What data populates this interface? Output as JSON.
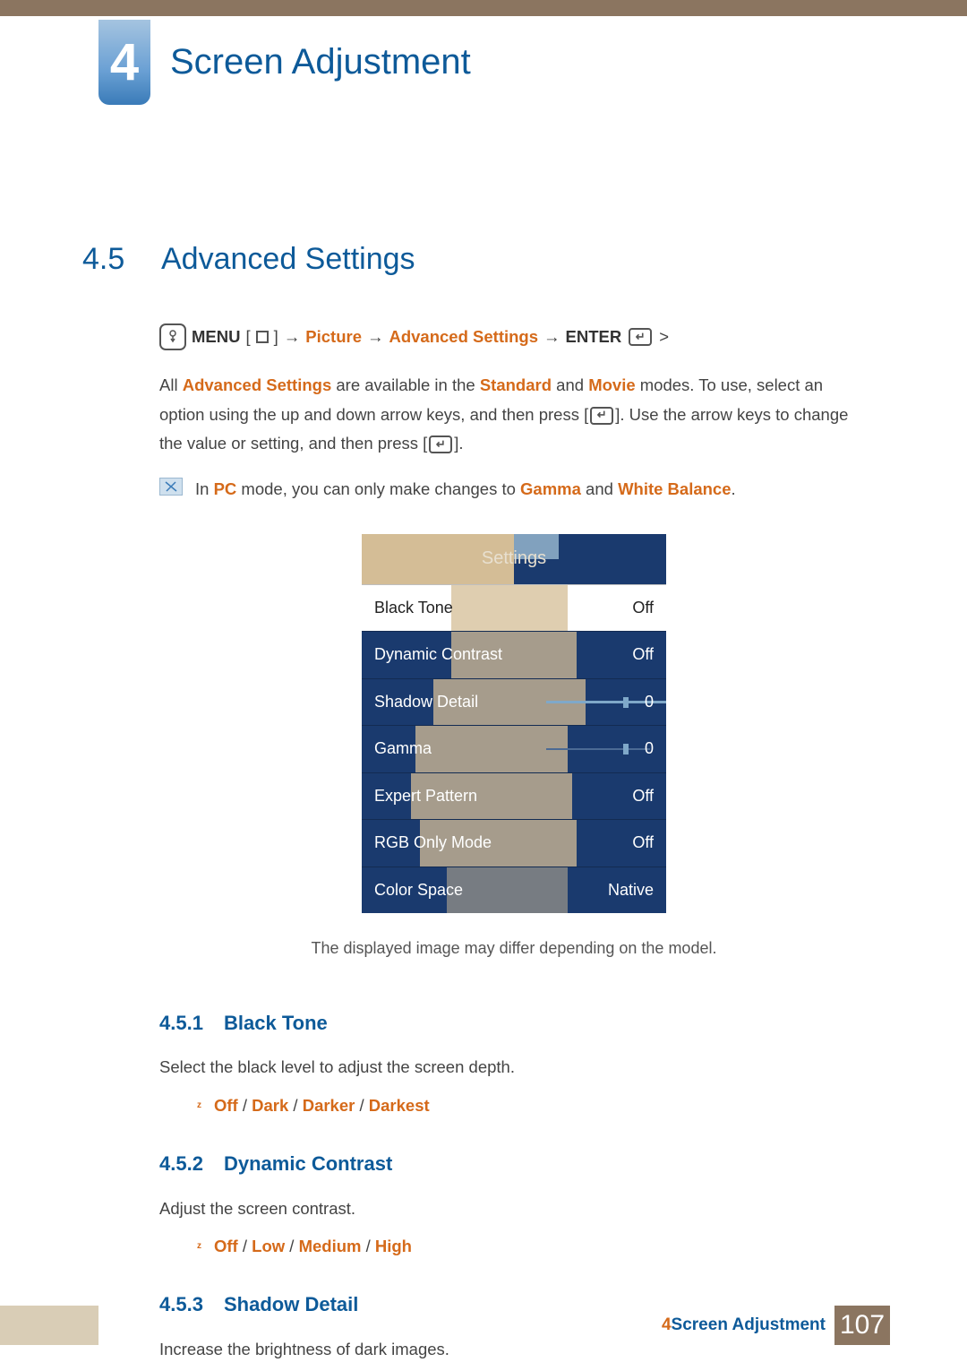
{
  "chapter": {
    "number": "4",
    "title": "Screen Adjustment"
  },
  "section": {
    "number": "4.5",
    "title": "Advanced Settings"
  },
  "navpath": {
    "menu": "MENU",
    "lbrack": "[",
    "rbrack": "]",
    "arrow": "→",
    "picture": "Picture",
    "adv": "Advanced Settings",
    "enter": "ENTER",
    "gt": ">"
  },
  "para1": {
    "t1": "All ",
    "adv": "Advanced Settings",
    "t2": " are available in the ",
    "std": "Standard",
    "t3": " and ",
    "mov": "Movie",
    "t4": " modes. To use, select an option using the up and down arrow keys, and then press [",
    "t5": "]. Use the arrow keys to change the value or setting, and then press [",
    "t6": "]."
  },
  "note": {
    "t1": "In ",
    "pc": "PC",
    "t2": " mode, you can only make changes to ",
    "gamma": "Gamma",
    "t3": " and ",
    "wb": "White Balance",
    "t4": "."
  },
  "osd": {
    "title": "Settings",
    "rows": [
      {
        "label": "Black Tone",
        "value": "Off"
      },
      {
        "label": "Dynamic Contrast",
        "value": "Off"
      },
      {
        "label": "Shadow Detail",
        "value": "0"
      },
      {
        "label": "Gamma",
        "value": "0"
      },
      {
        "label": "Expert Pattern",
        "value": "Off"
      },
      {
        "label": "RGB Only Mode",
        "value": "Off"
      },
      {
        "label": "Color Space",
        "value": "Native"
      }
    ]
  },
  "caption": "The displayed image may differ depending on the model.",
  "sub1": {
    "num": "4.5.1",
    "title": "Black Tone",
    "desc": "Select the black level to adjust the screen depth.",
    "opt": {
      "a": "Off",
      "b": "Dark",
      "c": "Darker",
      "d": "Darkest",
      "sep": " / "
    }
  },
  "sub2": {
    "num": "4.5.2",
    "title": "Dynamic Contrast",
    "desc": "Adjust the screen contrast.",
    "opt": {
      "a": "Off",
      "b": "Low",
      "c": "Medium",
      "d": "High",
      "sep": " / "
    }
  },
  "sub3": {
    "num": "4.5.3",
    "title": "Shadow Detail",
    "desc": "Increase the brightness of dark images."
  },
  "footer": {
    "label_num": "4",
    "label_text": " Screen Adjustment",
    "page": "107"
  }
}
